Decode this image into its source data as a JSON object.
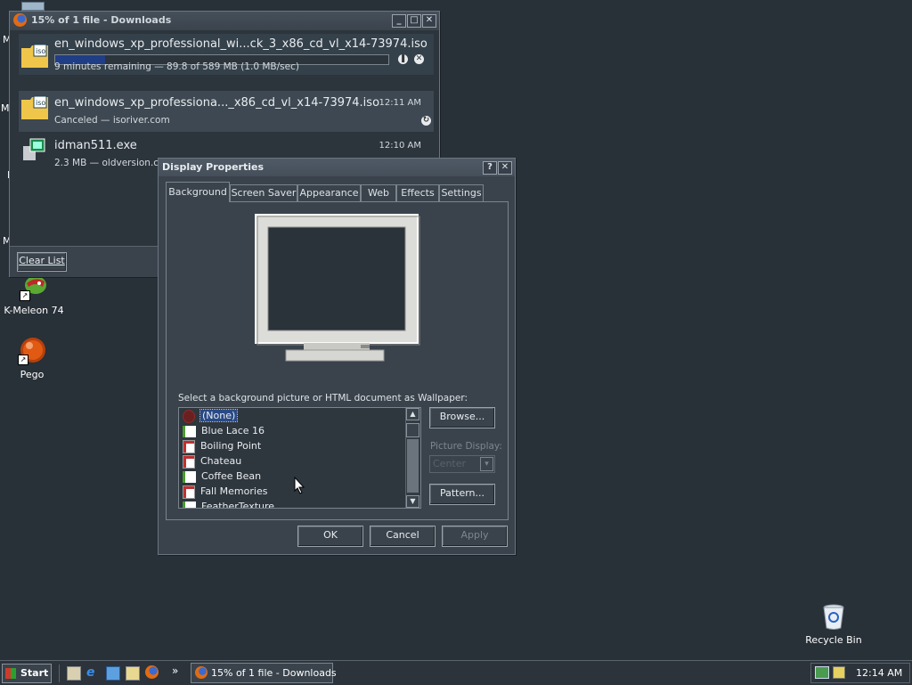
{
  "desktop": {
    "icons": [
      {
        "label": "K-Meleon 74"
      },
      {
        "label": "Pego"
      },
      {
        "label": "Recycle Bin"
      }
    ],
    "edge_letters": [
      "M",
      "M",
      "M",
      "I"
    ]
  },
  "downloads": {
    "title": "15% of 1 file - Downloads",
    "items": [
      {
        "name": "en_windows_xp_professional_wi...ck_3_x86_cd_vl_x14-73974.iso",
        "status": "9 minutes remaining — 89.8 of 589 MB (1.0 MB/sec)",
        "progress": 0.15,
        "icon": "iso-file-icon"
      },
      {
        "name": "en_windows_xp_professiona..._x86_cd_vl_x14-73974.iso",
        "status": "Canceled — isoriver.com",
        "time": "12:11 AM",
        "icon": "iso-file-icon"
      },
      {
        "name": "idman511.exe",
        "status": "2.3 MB — oldversion.com",
        "time": "12:10 AM",
        "icon": "installer-icon"
      }
    ],
    "clear_list": "Clear List"
  },
  "display": {
    "title": "Display Properties",
    "tabs": [
      "Background",
      "Screen Saver",
      "Appearance",
      "Web",
      "Effects",
      "Settings"
    ],
    "active_tab": "Background",
    "wallpaper_label": "Select a background picture or HTML document as Wallpaper:",
    "wallpapers": [
      "(None)",
      "Blue Lace 16",
      "Boiling Point",
      "Chateau",
      "Coffee Bean",
      "Fall Memories",
      "FeatherTexture"
    ],
    "selected_wallpaper": "(None)",
    "browse": "Browse...",
    "picture_display_label": "Picture Display:",
    "picture_display_value": "Center",
    "pattern": "Pattern...",
    "ok": "OK",
    "cancel": "Cancel",
    "apply": "Apply"
  },
  "taskbar": {
    "start": "Start",
    "task": "15% of 1 file - Downloads",
    "clock": "12:14 AM",
    "chevron": "»"
  },
  "colors": {
    "desktop": "#283038",
    "selection": "#2a4a86",
    "progress": "#203e86"
  }
}
